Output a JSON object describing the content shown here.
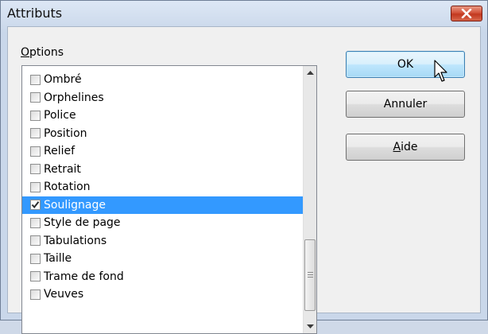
{
  "window": {
    "title": "Attributs"
  },
  "options": {
    "label_accel": "O",
    "label_rest": "ptions",
    "items": [
      {
        "label": "Ombré",
        "checked": false,
        "selected": false
      },
      {
        "label": "Orphelines",
        "checked": false,
        "selected": false
      },
      {
        "label": "Police",
        "checked": false,
        "selected": false
      },
      {
        "label": "Position",
        "checked": false,
        "selected": false
      },
      {
        "label": "Relief",
        "checked": false,
        "selected": false
      },
      {
        "label": "Retrait",
        "checked": false,
        "selected": false
      },
      {
        "label": "Rotation",
        "checked": false,
        "selected": false
      },
      {
        "label": "Soulignage",
        "checked": true,
        "selected": true
      },
      {
        "label": "Style de page",
        "checked": false,
        "selected": false
      },
      {
        "label": "Tabulations",
        "checked": false,
        "selected": false
      },
      {
        "label": "Taille",
        "checked": false,
        "selected": false
      },
      {
        "label": "Trame de fond",
        "checked": false,
        "selected": false
      },
      {
        "label": "Veuves",
        "checked": false,
        "selected": false
      }
    ]
  },
  "buttons": {
    "ok": "OK",
    "cancel": "Annuler",
    "help_accel": "A",
    "help_rest": "ide"
  },
  "icons": {
    "close": "close-icon",
    "scroll_up": "chevron-up-icon",
    "scroll_down": "chevron-down-icon",
    "cursor": "mouse-pointer-icon"
  },
  "colors": {
    "selection": "#3399ff",
    "close_button": "#c2381f",
    "default_button_border": "#3c7fb1"
  }
}
